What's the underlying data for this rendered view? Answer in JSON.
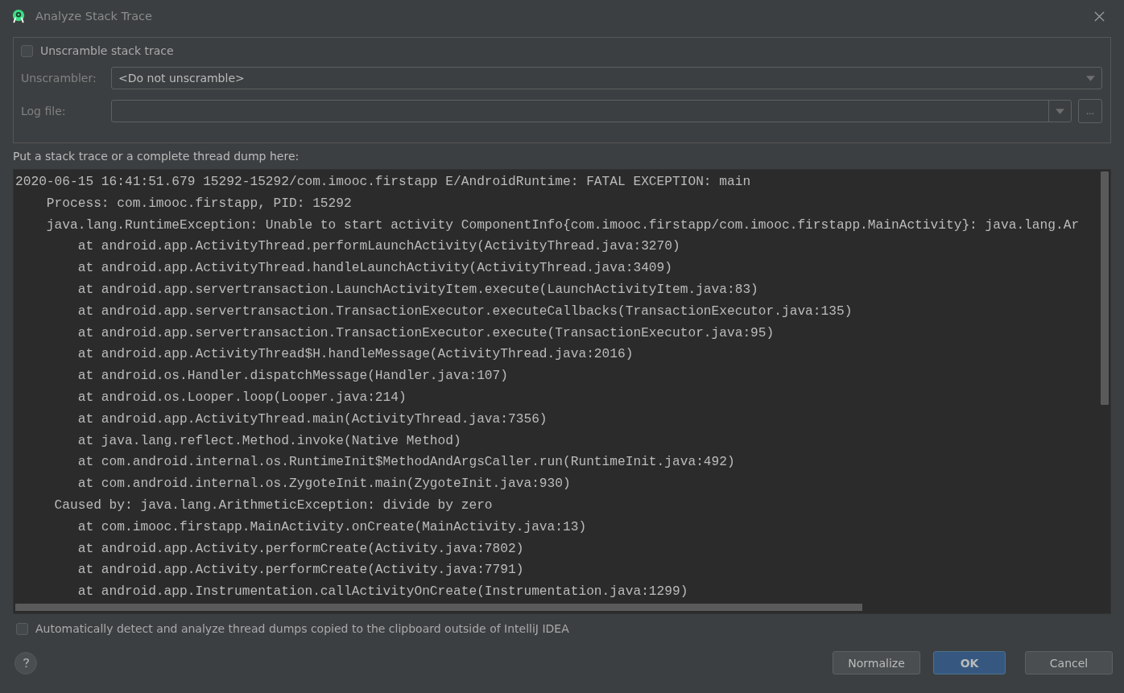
{
  "window": {
    "title": "Analyze Stack Trace"
  },
  "unscramble": {
    "label": "Unscramble stack trace",
    "checked": false
  },
  "unscrambler": {
    "label": "Unscrambler:",
    "value": "<Do not unscramble>"
  },
  "log_file": {
    "label": "Log file:",
    "browse": "..."
  },
  "trace_label": "Put a stack trace or a complete thread dump here:",
  "trace_lines": [
    "2020-06-15 16:41:51.679 15292-15292/com.imooc.firstapp E/AndroidRuntime: FATAL EXCEPTION: main",
    "    Process: com.imooc.firstapp, PID: 15292",
    "    java.lang.RuntimeException: Unable to start activity ComponentInfo{com.imooc.firstapp/com.imooc.firstapp.MainActivity}: java.lang.Ar",
    "        at android.app.ActivityThread.performLaunchActivity(ActivityThread.java:3270)",
    "        at android.app.ActivityThread.handleLaunchActivity(ActivityThread.java:3409)",
    "        at android.app.servertransaction.LaunchActivityItem.execute(LaunchActivityItem.java:83)",
    "        at android.app.servertransaction.TransactionExecutor.executeCallbacks(TransactionExecutor.java:135)",
    "        at android.app.servertransaction.TransactionExecutor.execute(TransactionExecutor.java:95)",
    "        at android.app.ActivityThread$H.handleMessage(ActivityThread.java:2016)",
    "        at android.os.Handler.dispatchMessage(Handler.java:107)",
    "        at android.os.Looper.loop(Looper.java:214)",
    "        at android.app.ActivityThread.main(ActivityThread.java:7356)",
    "        at java.lang.reflect.Method.invoke(Native Method)",
    "        at com.android.internal.os.RuntimeInit$MethodAndArgsCaller.run(RuntimeInit.java:492)",
    "        at com.android.internal.os.ZygoteInit.main(ZygoteInit.java:930)",
    "     Caused by: java.lang.ArithmeticException: divide by zero",
    "        at com.imooc.firstapp.MainActivity.onCreate(MainActivity.java:13)",
    "        at android.app.Activity.performCreate(Activity.java:7802)",
    "        at android.app.Activity.performCreate(Activity.java:7791)",
    "        at android.app.Instrumentation.callActivityOnCreate(Instrumentation.java:1299)"
  ],
  "auto_detect": {
    "label": "Automatically detect and analyze thread dumps copied to the clipboard outside of IntelliJ IDEA",
    "checked": false
  },
  "buttons": [
    {
      "label": "Normalize",
      "kind": "normal"
    },
    {
      "label": "OK",
      "kind": "default"
    },
    {
      "label": "Cancel",
      "kind": "normal"
    }
  ]
}
